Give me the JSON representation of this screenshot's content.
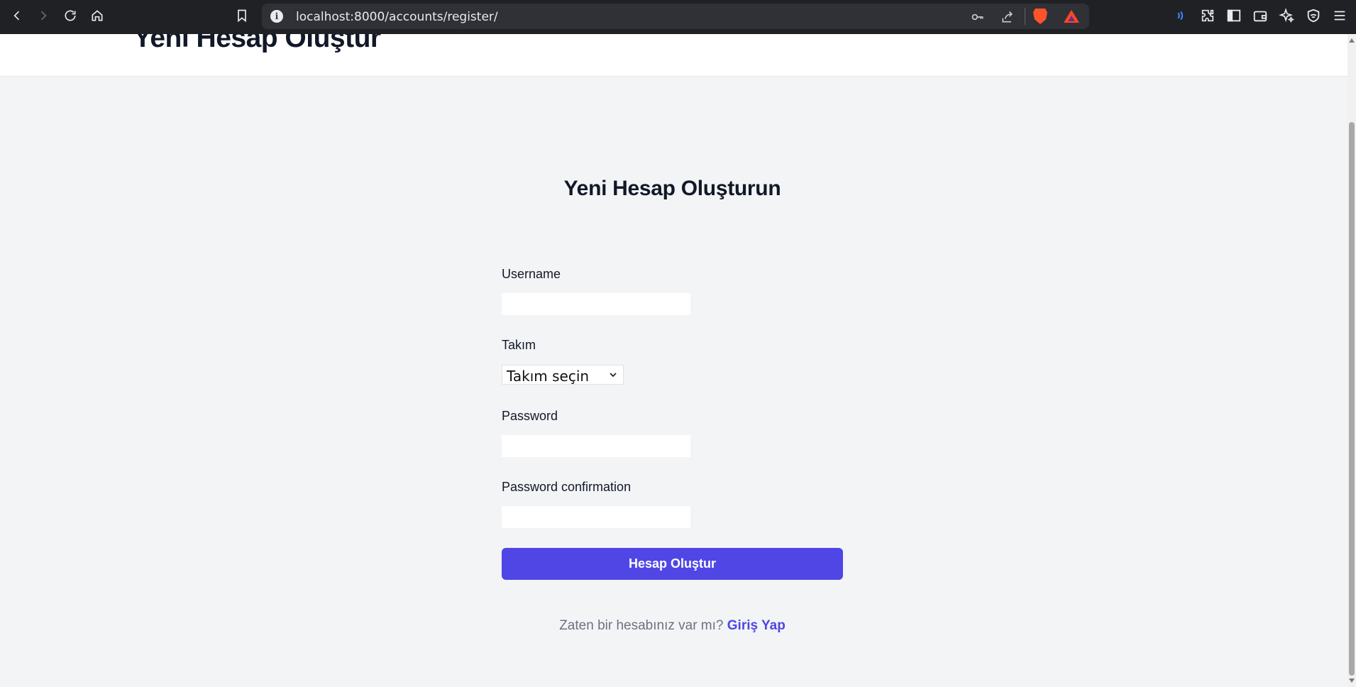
{
  "browser": {
    "url": "localhost:8000/accounts/register/"
  },
  "header": {
    "title": "Yeni Hesap Oluştur"
  },
  "form": {
    "title": "Yeni Hesap Oluşturun",
    "username_label": "Username",
    "username_value": "",
    "team_label": "Takım",
    "team_selected": "Takım seçin",
    "password_label": "Password",
    "password_value": "",
    "password_confirm_label": "Password confirmation",
    "password_confirm_value": "",
    "submit_label": "Hesap Oluştur"
  },
  "footer": {
    "prompt": "Zaten bir hesabınız var mı?",
    "login_link": "Giriş Yap"
  },
  "colors": {
    "accent": "#4f46e5",
    "page_bg": "#f3f4f6",
    "heading": "#111827"
  }
}
